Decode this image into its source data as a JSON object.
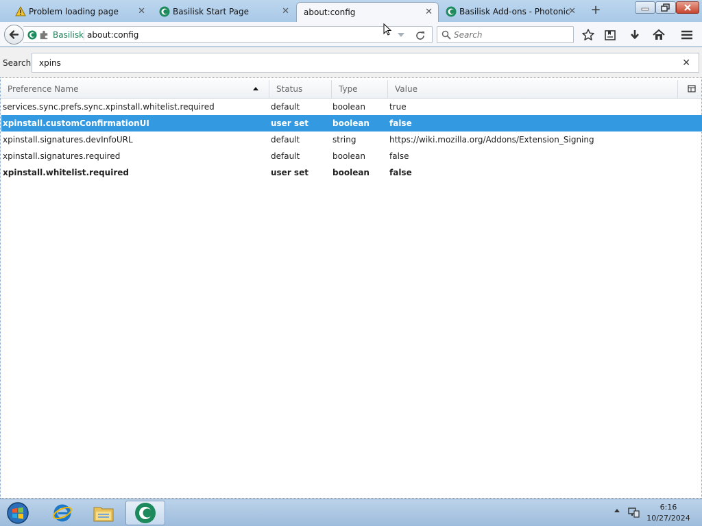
{
  "tabs": [
    {
      "title": "Problem loading page",
      "icon": "warning-icon",
      "active": false
    },
    {
      "title": "Basilisk Start Page",
      "icon": "basilisk-icon",
      "active": false
    },
    {
      "title": "about:config",
      "icon": "",
      "active": true
    },
    {
      "title": "Basilisk Add-ons - Photonic",
      "icon": "basilisk-icon",
      "active": false
    }
  ],
  "urlbar": {
    "identity_label": "Basilisk",
    "url": "about:config"
  },
  "searchbar": {
    "placeholder": "Search"
  },
  "config": {
    "search_label": "Search:",
    "search_value": "xpins",
    "columns": [
      "Preference Name",
      "Status",
      "Type",
      "Value"
    ],
    "rows": [
      {
        "name": "services.sync.prefs.sync.xpinstall.whitelist.required",
        "status": "default",
        "type": "boolean",
        "value": "true",
        "modified": false,
        "selected": false
      },
      {
        "name": "xpinstall.customConfirmationUI",
        "status": "user set",
        "type": "boolean",
        "value": "false",
        "modified": true,
        "selected": true
      },
      {
        "name": "xpinstall.signatures.devInfoURL",
        "status": "default",
        "type": "string",
        "value": "https://wiki.mozilla.org/Addons/Extension_Signing",
        "modified": false,
        "selected": false
      },
      {
        "name": "xpinstall.signatures.required",
        "status": "default",
        "type": "boolean",
        "value": "false",
        "modified": false,
        "selected": false
      },
      {
        "name": "xpinstall.whitelist.required",
        "status": "user set",
        "type": "boolean",
        "value": "false",
        "modified": true,
        "selected": false
      }
    ]
  },
  "taskbar": {
    "items": [
      "start-orb-icon",
      "internet-explorer-icon",
      "file-explorer-icon",
      "basilisk-icon"
    ],
    "time": "6:16",
    "date": "10/27/2024"
  },
  "colors": {
    "selection": "#3399e1",
    "basilisk_green": "#1d7d55"
  }
}
